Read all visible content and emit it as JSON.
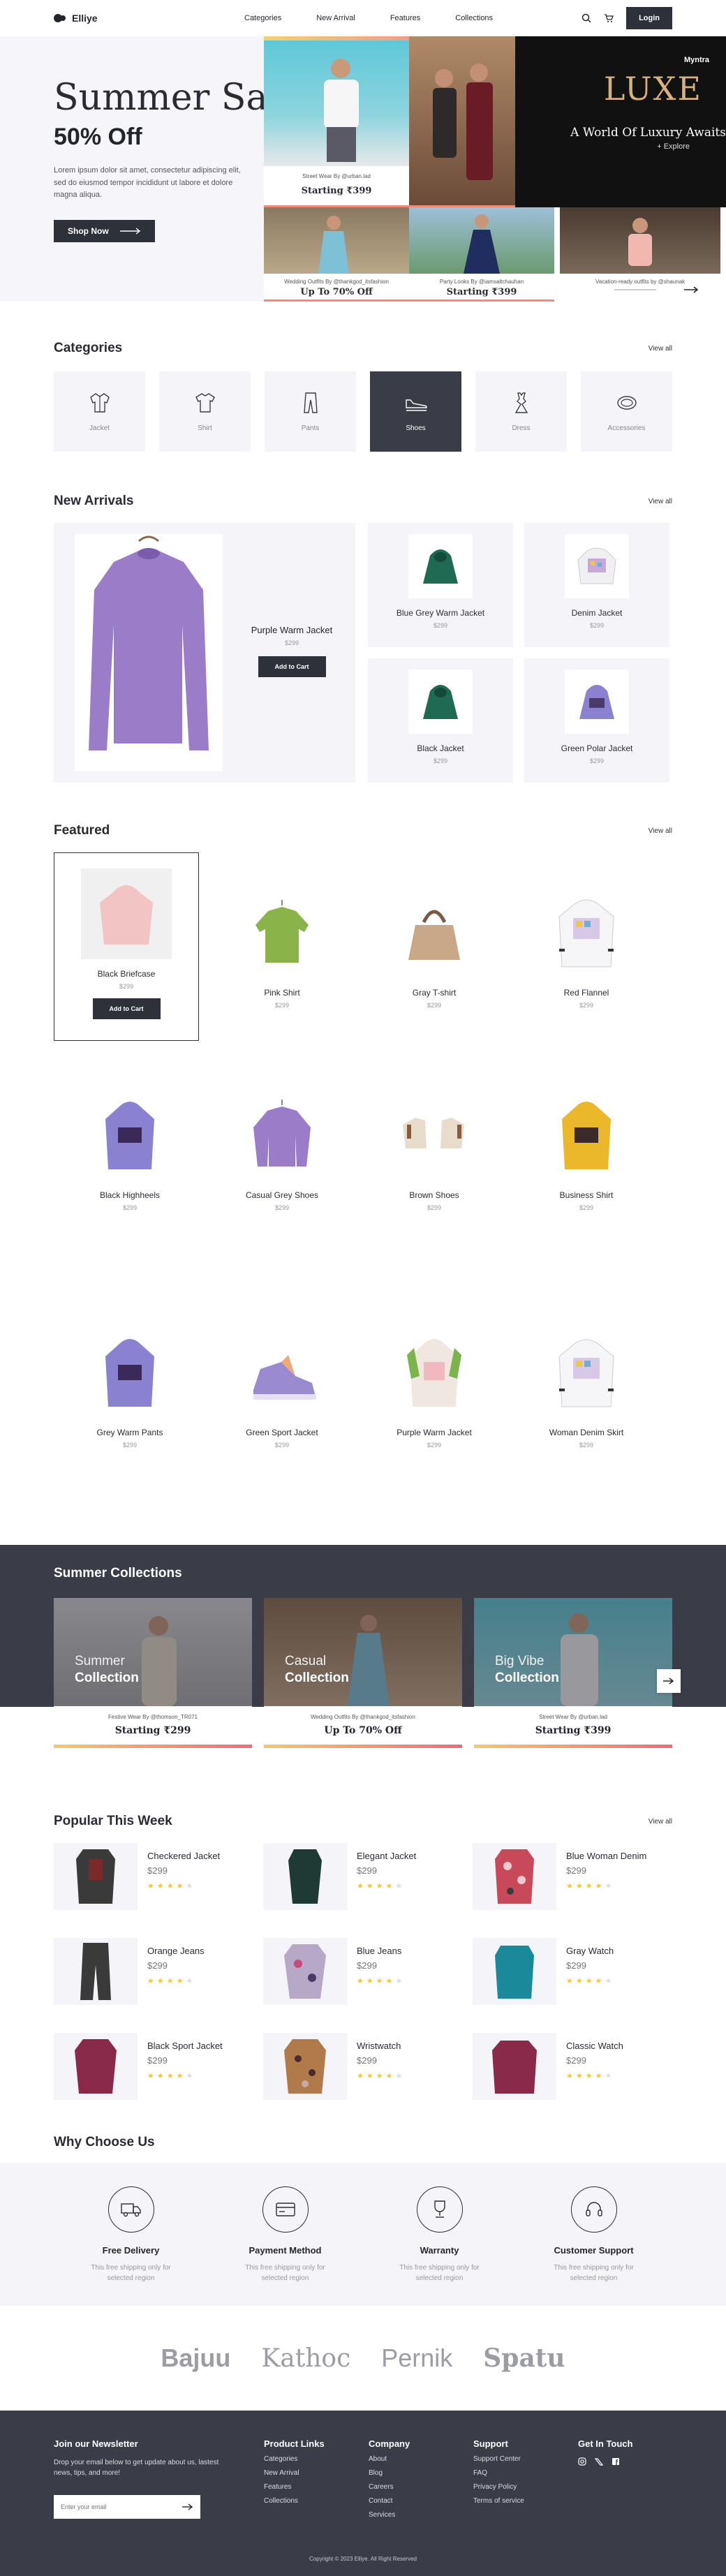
{
  "nav": {
    "brand": "Elliye",
    "links": [
      "Categories",
      "New Arrival",
      "Features",
      "Collections"
    ],
    "login": "Login"
  },
  "hero": {
    "title": "Summer Sale",
    "subtitle": "50% Off",
    "description": "Lorem ipsum dolor sit amet, consectetur adipiscing elit, sed do eiusmod tempor incididunt ut labore et dolore magna aliqua.",
    "cta": "Shop Now",
    "promos": [
      {
        "caption": "Street Wear By @urban.lad",
        "headline": "Starting ₹399"
      },
      {
        "caption": "Wedding Outfits By @thankgod_itsfashion",
        "headline": "Up To 70% Off"
      },
      {
        "caption": "Party Looks By @iamsaltchauhan",
        "headline": "Starting ₹399"
      },
      {
        "caption": "Vacation-ready outfits by @shaunak",
        "headline": ""
      }
    ],
    "luxe": {
      "brand": "Myntra",
      "word": "LUXE",
      "tagline": "A World Of Luxury Awaits",
      "link": "+ Explore"
    }
  },
  "categories": {
    "title": "Categories",
    "view_all": "View all",
    "items": [
      {
        "label": "Jacket",
        "icon": "jacket-icon"
      },
      {
        "label": "Shirt",
        "icon": "shirt-icon"
      },
      {
        "label": "Pants",
        "icon": "pants-icon"
      },
      {
        "label": "Shoes",
        "icon": "shoe-icon"
      },
      {
        "label": "Dress",
        "icon": "dress-icon"
      },
      {
        "label": "Accessories",
        "icon": "accessories-icon"
      }
    ]
  },
  "arrivals": {
    "title": "New Arrivals",
    "view_all": "View all",
    "featured": {
      "name": "Purple Warm Jacket",
      "price": "$299",
      "button": "Add to Cart"
    },
    "items": [
      {
        "name": "Blue Grey Warm Jacket",
        "price": "$299"
      },
      {
        "name": "Denim Jacket",
        "price": "$299"
      },
      {
        "name": "Black Jacket",
        "price": "$299"
      },
      {
        "name": "Green Polar Jacket",
        "price": "$299"
      }
    ]
  },
  "featured": {
    "title": "Featured",
    "view_all": "View all",
    "button": "Add to Cart",
    "items": [
      {
        "name": "Black Briefcase",
        "price": "$299"
      },
      {
        "name": "Pink Shirt",
        "price": "$299"
      },
      {
        "name": "Gray T-shirt",
        "price": "$299"
      },
      {
        "name": "Red Flannel",
        "price": "$299"
      },
      {
        "name": "Black Highheels",
        "price": "$299"
      },
      {
        "name": "Casual Grey Shoes",
        "price": "$299"
      },
      {
        "name": "Brown Shoes",
        "price": "$299"
      },
      {
        "name": "Business Shirt",
        "price": "$299"
      },
      {
        "name": "Grey Warm Pants",
        "price": "$299"
      },
      {
        "name": "Green Sport Jacket",
        "price": "$299"
      },
      {
        "name": "Purple Warm Jacket",
        "price": "$299"
      },
      {
        "name": "Woman Denim Skirt",
        "price": "$299"
      }
    ]
  },
  "summer": {
    "title": "Summer Collections",
    "cards": [
      {
        "label1": "Summer",
        "label2": "Collection",
        "caption": "Festive Wear By @thomson_TR071",
        "headline": "Starting ₹299"
      },
      {
        "label1": "Casual",
        "label2": "Collection",
        "caption": "Wedding Outfits By @thankgod_itsfashion",
        "headline": "Up To 70% Off"
      },
      {
        "label1": "Big Vibe",
        "label2": "Collection",
        "caption": "Street Wear By @urban.lad",
        "headline": "Starting ₹399"
      }
    ]
  },
  "popular": {
    "title": "Popular This Week",
    "view_all": "View all",
    "items": [
      {
        "name": "Checkered Jacket",
        "price": "$299",
        "rating": 4
      },
      {
        "name": "Elegant Jacket",
        "price": "$299",
        "rating": 4
      },
      {
        "name": "Blue Woman Denim",
        "price": "$299",
        "rating": 4
      },
      {
        "name": "Orange Jeans",
        "price": "$299",
        "rating": 4
      },
      {
        "name": "Blue Jeans",
        "price": "$299",
        "rating": 4
      },
      {
        "name": "Gray Watch",
        "price": "$299",
        "rating": 4
      },
      {
        "name": "Black Sport Jacket",
        "price": "$299",
        "rating": 4
      },
      {
        "name": "Wristwatch",
        "price": "$299",
        "rating": 4
      },
      {
        "name": "Classic Watch",
        "price": "$299",
        "rating": 4
      }
    ]
  },
  "why": {
    "title": "Why Choose Us",
    "items": [
      {
        "title": "Free Delivery",
        "desc": "This free shipping only for selected region",
        "icon": "truck-icon"
      },
      {
        "title": "Payment Method",
        "desc": "This free shipping only for selected region",
        "icon": "card-icon"
      },
      {
        "title": "Warranty",
        "desc": "This free shipping only for selected region",
        "icon": "trophy-icon"
      },
      {
        "title": "Customer Support",
        "desc": "This free shipping only for selected region",
        "icon": "headset-icon"
      }
    ]
  },
  "brands": [
    "Bajuu",
    "Kathoc",
    "Pernik",
    "Spatu"
  ],
  "footer": {
    "newsletter": {
      "title": "Join our Newsletter",
      "desc": "Drop your email below to get update about us, lastest news, tips, and more!",
      "placeholder": "Enter your email"
    },
    "product_links": {
      "title": "Product Links",
      "links": [
        "Categories",
        "New Arrival",
        "Features",
        "Collections"
      ]
    },
    "company": {
      "title": "Company",
      "links": [
        "About",
        "Blog",
        "Careers",
        "Contact",
        "Services"
      ]
    },
    "support": {
      "title": "Support",
      "links": [
        "Support Center",
        "FAQ",
        "Privacy Policy",
        "Terms of service"
      ]
    },
    "touch": {
      "title": "Get In Touch"
    },
    "copyright": "Copyright © 2023 Elliye. All Right Reserved"
  }
}
